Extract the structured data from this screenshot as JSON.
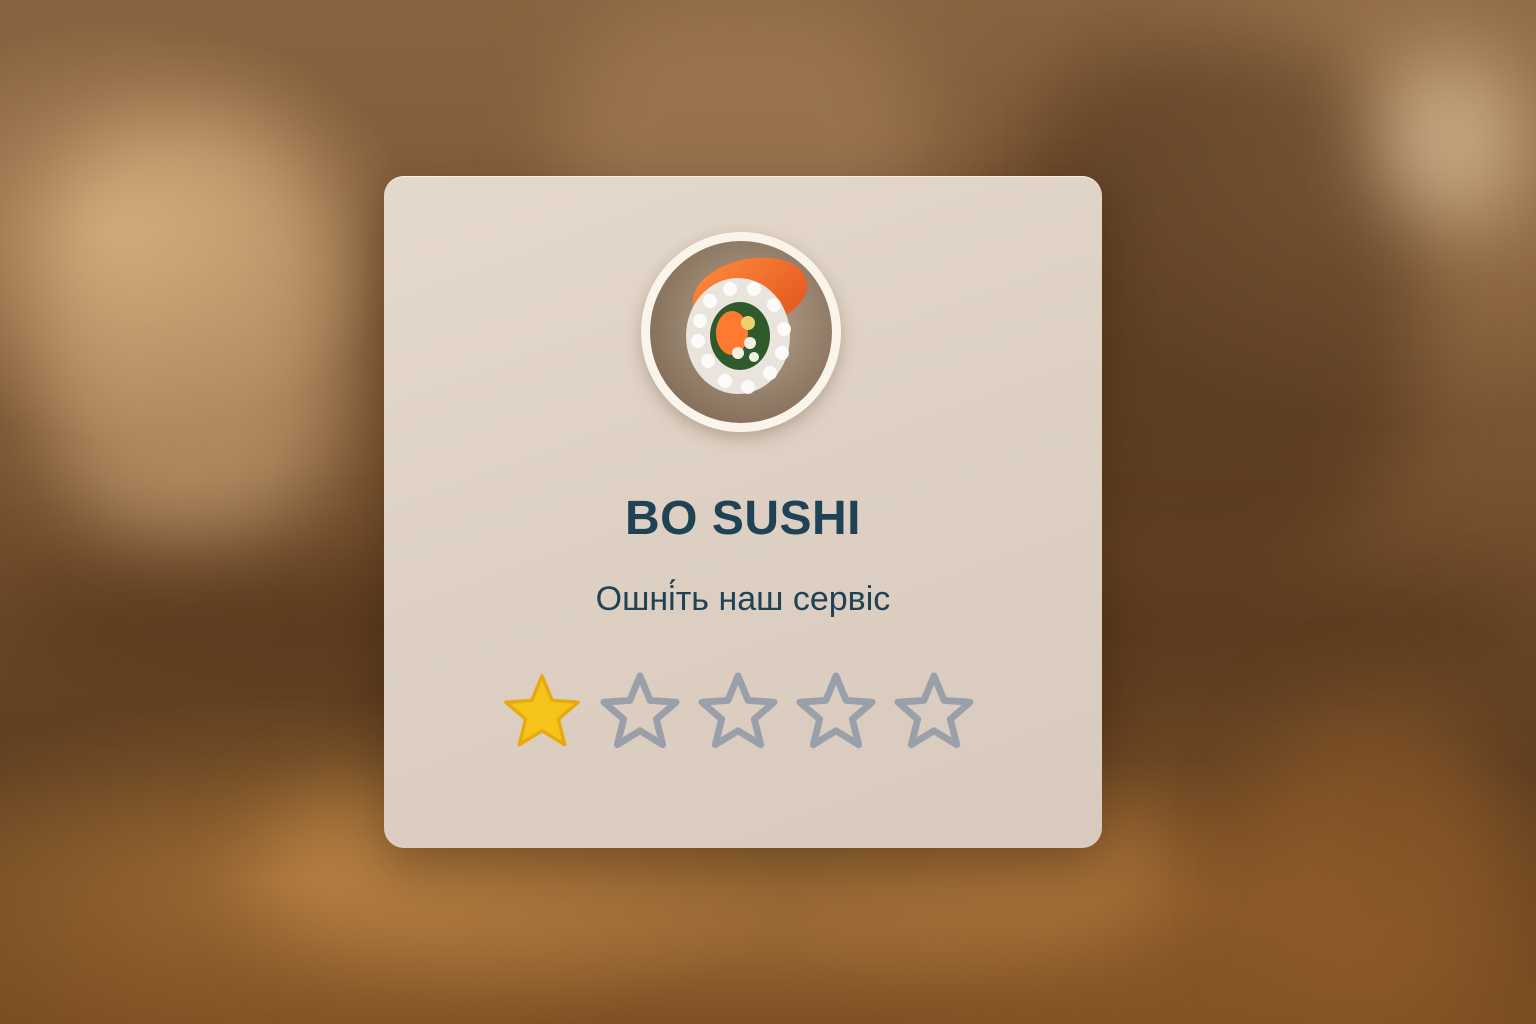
{
  "card": {
    "restaurant_name": "BO SUSHI",
    "prompt": "Ошні́ть наш сервіс"
  },
  "rating": {
    "max_stars": 5,
    "selected": 1
  },
  "colors": {
    "title": "#1f4255",
    "star_filled": "#f6c31b",
    "star_empty": "#9aa0aa"
  },
  "icons": {
    "avatar": "sushi-roll-photo",
    "star": "star-icon"
  }
}
